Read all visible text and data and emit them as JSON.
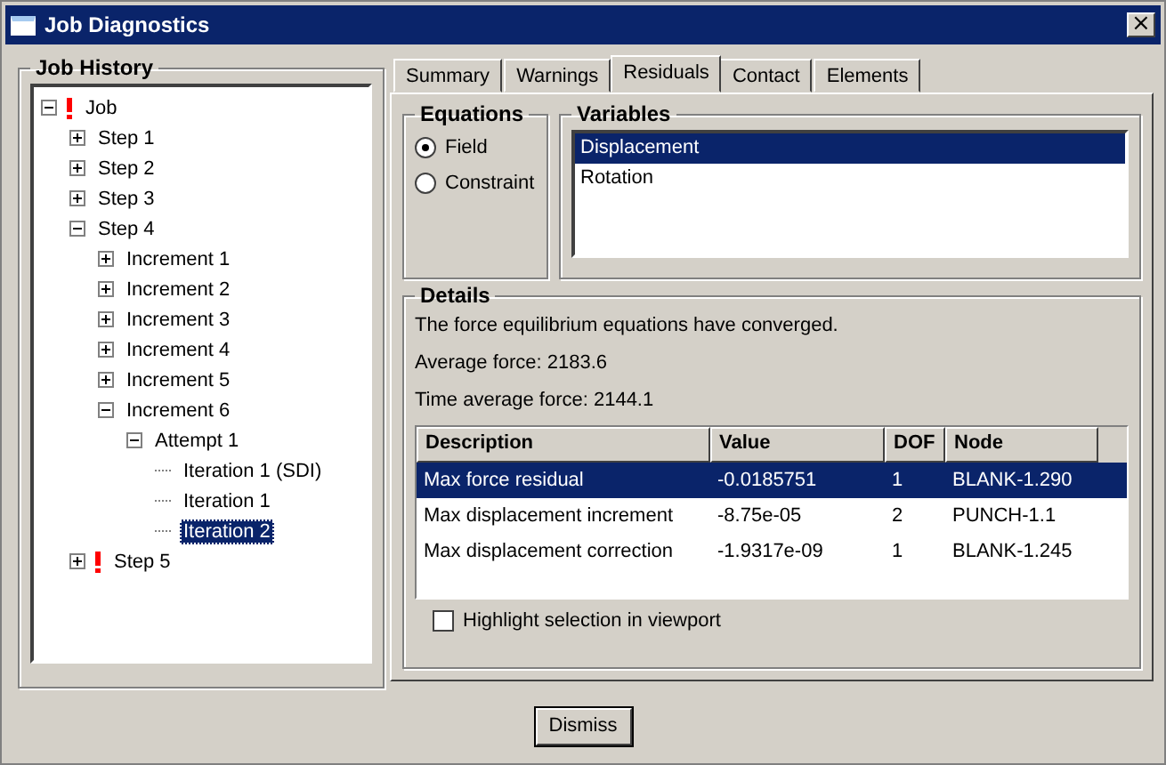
{
  "window": {
    "title": "Job Diagnostics",
    "close": "×"
  },
  "job_history": {
    "title": "Job History",
    "tree": [
      {
        "label": "Job",
        "warning": true,
        "expanded": true,
        "selected": false,
        "children": [
          {
            "label": "Step 1",
            "warning": false,
            "expanded": false,
            "selected": false
          },
          {
            "label": "Step 2",
            "warning": false,
            "expanded": false,
            "selected": false
          },
          {
            "label": "Step 3",
            "warning": false,
            "expanded": false,
            "selected": false
          },
          {
            "label": "Step 4",
            "warning": false,
            "expanded": true,
            "selected": false,
            "children": [
              {
                "label": "Increment 1",
                "warning": false,
                "expanded": false,
                "selected": false
              },
              {
                "label": "Increment 2",
                "warning": false,
                "expanded": false,
                "selected": false
              },
              {
                "label": "Increment 3",
                "warning": false,
                "expanded": false,
                "selected": false
              },
              {
                "label": "Increment 4",
                "warning": false,
                "expanded": false,
                "selected": false
              },
              {
                "label": "Increment 5",
                "warning": false,
                "expanded": false,
                "selected": false
              },
              {
                "label": "Increment 6",
                "warning": false,
                "expanded": true,
                "selected": false,
                "children": [
                  {
                    "label": "Attempt 1",
                    "warning": false,
                    "expanded": true,
                    "selected": false,
                    "children": [
                      {
                        "label": "Iteration 1 (SDI)",
                        "warning": false,
                        "selected": false
                      },
                      {
                        "label": "Iteration 1",
                        "warning": false,
                        "selected": false
                      },
                      {
                        "label": "Iteration 2",
                        "warning": false,
                        "selected": true
                      }
                    ]
                  }
                ]
              }
            ]
          },
          {
            "label": "Step 5",
            "warning": true,
            "expanded": false,
            "selected": false
          }
        ]
      }
    ]
  },
  "tabs": [
    {
      "label": "Summary",
      "selected": false
    },
    {
      "label": "Warnings",
      "selected": false
    },
    {
      "label": "Residuals",
      "selected": true
    },
    {
      "label": "Contact",
      "selected": false
    },
    {
      "label": "Elements",
      "selected": false
    }
  ],
  "equations": {
    "title": "Equations",
    "options": [
      {
        "label": "Field",
        "selected": true
      },
      {
        "label": "Constraint",
        "selected": false
      }
    ]
  },
  "variables": {
    "title": "Variables",
    "items": [
      {
        "label": "Displacement",
        "selected": true
      },
      {
        "label": "Rotation",
        "selected": false
      }
    ]
  },
  "details": {
    "title": "Details",
    "lines": [
      "The force equilibrium equations have converged.",
      "Average force: 2183.6",
      "Time average force: 2144.1"
    ],
    "table": {
      "columns": [
        "Description",
        "Value",
        "DOF",
        "Node"
      ],
      "rows": [
        {
          "cells": [
            "Max force residual",
            "-0.0185751",
            "1",
            "BLANK-1.290"
          ],
          "selected": true
        },
        {
          "cells": [
            "Max displacement increment",
            "-8.75e-05",
            "2",
            "PUNCH-1.1"
          ],
          "selected": false
        },
        {
          "cells": [
            "Max displacement correction",
            "-1.9317e-09",
            "1",
            "BLANK-1.245"
          ],
          "selected": false
        }
      ]
    },
    "highlight": {
      "label": "Highlight selection in viewport",
      "checked": false
    }
  },
  "buttons": [
    "Dismiss"
  ]
}
